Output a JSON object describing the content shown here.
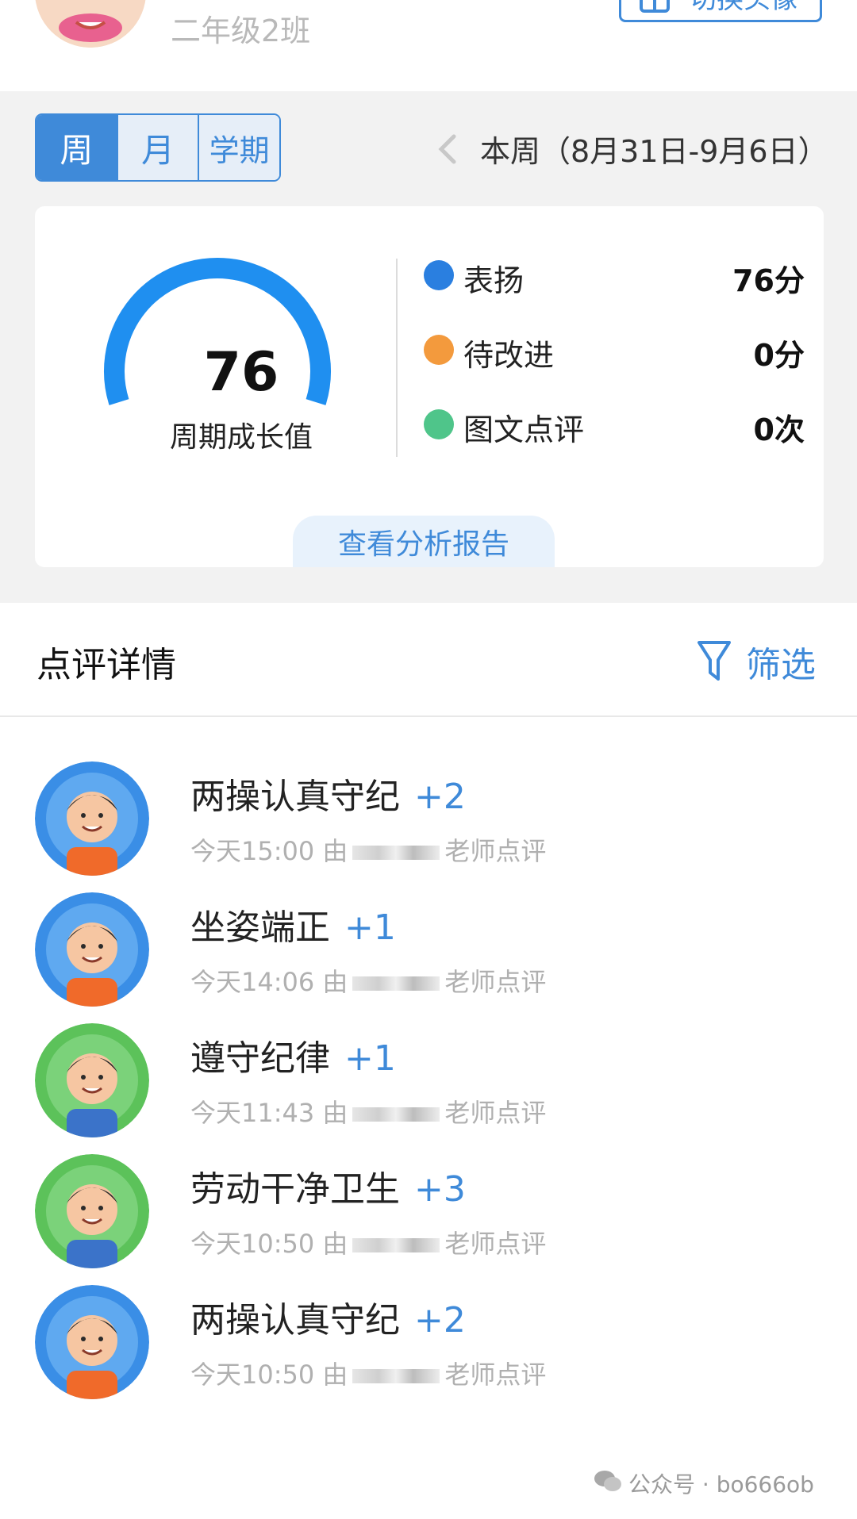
{
  "profile": {
    "class_name": "二年级2班",
    "switch_button": "切换头像"
  },
  "period_tabs": [
    "周",
    "月",
    "学期"
  ],
  "active_period": "周",
  "week_range": "本周（8月31日-9月6日）",
  "growth": {
    "value": "76",
    "caption": "周期成长值",
    "fill_fraction": 1.0
  },
  "stats": [
    {
      "name": "表扬",
      "value": "76分",
      "color": "#2a7fe0"
    },
    {
      "name": "待改进",
      "value": "0分",
      "color": "#f39a3d"
    },
    {
      "name": "图文点评",
      "value": "0次",
      "color": "#4fc58a"
    }
  ],
  "report_button": "查看分析报告",
  "section": {
    "title": "点评详情",
    "filter_label": "筛选"
  },
  "reviews": [
    {
      "title": "两操认真守纪",
      "points": "+2",
      "time": "今天15:00 由",
      "suffix": "老师点评",
      "avatar": "blue"
    },
    {
      "title": "坐姿端正",
      "points": "+1",
      "time": "今天14:06 由",
      "suffix": "老师点评",
      "avatar": "blue"
    },
    {
      "title": "遵守纪律",
      "points": "+1",
      "time": "今天11:43 由",
      "suffix": "老师点评",
      "avatar": "green"
    },
    {
      "title": "劳动干净卫生",
      "points": "+3",
      "time": "今天10:50 由",
      "suffix": "老师点评",
      "avatar": "green"
    },
    {
      "title": "两操认真守纪",
      "points": "+2",
      "time": "今天10:50 由",
      "suffix": "老师点评",
      "avatar": "blue"
    }
  ],
  "watermark": "公众号 · bo666ob",
  "colors": {
    "accent": "#3f8ad9",
    "gauge": "#1f8ff0",
    "page_bg": "#f2f2f2"
  }
}
